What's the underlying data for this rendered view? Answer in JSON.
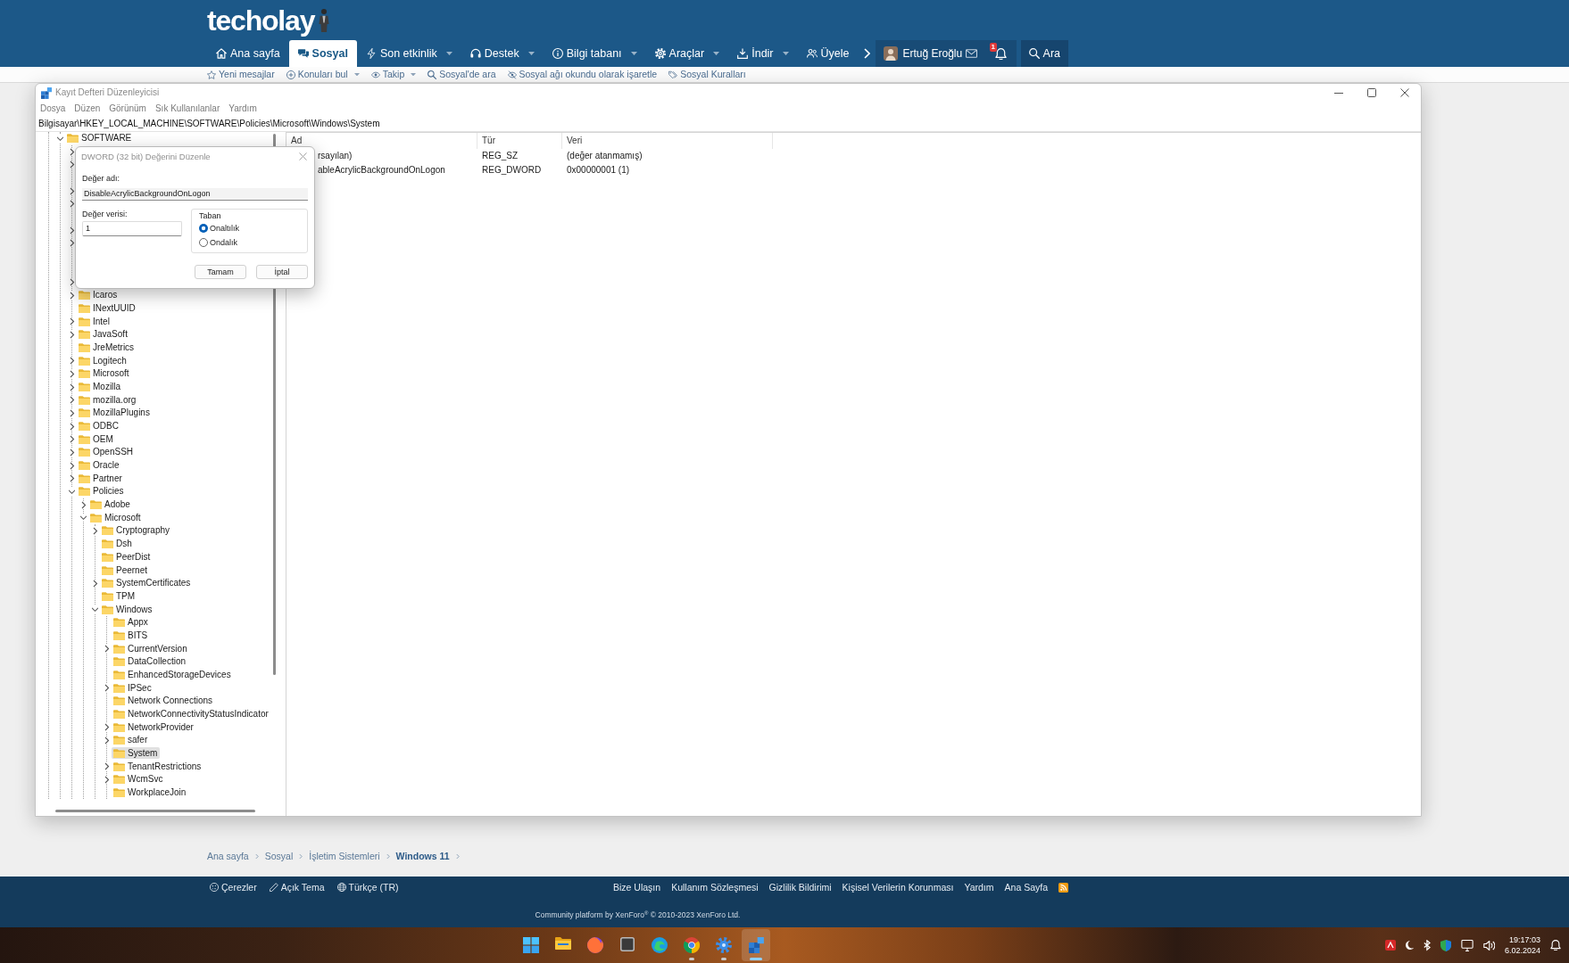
{
  "site": {
    "logo": "techolay",
    "nav": [
      {
        "label": "Ana sayfa",
        "selected": false,
        "has_menu": false
      },
      {
        "label": "Sosyal",
        "selected": true,
        "has_menu": false
      },
      {
        "label": "Son etkinlik",
        "selected": false,
        "has_menu": true
      },
      {
        "label": "Destek",
        "selected": false,
        "has_menu": true
      },
      {
        "label": "Bilgi tabanı",
        "selected": false,
        "has_menu": true
      },
      {
        "label": "Araçlar",
        "selected": false,
        "has_menu": true
      },
      {
        "label": "İndir",
        "selected": false,
        "has_menu": true
      },
      {
        "label": "Üyele",
        "selected": false,
        "has_menu": false
      }
    ],
    "account": {
      "user": "Ertuğ Eroğlu",
      "alerts": "1"
    },
    "search": "Ara",
    "subnav": [
      {
        "label": "Yeni mesajlar",
        "has_menu": false
      },
      {
        "label": "Konuları bul",
        "has_menu": true
      },
      {
        "label": "Takip",
        "has_menu": true
      },
      {
        "label": "Sosyal'de ara",
        "has_menu": false
      },
      {
        "label": "Sosyal ağı okundu olarak işaretle",
        "has_menu": false
      },
      {
        "label": "Sosyal Kuralları",
        "has_menu": false
      }
    ],
    "breadcrumb": [
      {
        "label": "Ana sayfa",
        "current": false
      },
      {
        "label": "Sosyal",
        "current": false
      },
      {
        "label": "İşletim Sistemleri",
        "current": false
      },
      {
        "label": "Windows 11",
        "current": true
      }
    ],
    "footer": {
      "left": [
        "Çerezler",
        "Açık Tema",
        "Türkçe (TR)"
      ],
      "right": [
        "Bize Ulaşın",
        "Kullanım Sözleşmesi",
        "Gizlilik Bildirimi",
        "Kişisel Verilerin Korunması",
        "Yardım",
        "Ana Sayfa"
      ],
      "copyright": "Community platform by XenForo$^{®}$ © 2010-2023 XenForo Ltd."
    }
  },
  "regedit": {
    "title": "Kayıt Defteri Düzenleyicisi",
    "menu": [
      "Dosya",
      "Düzen",
      "Görünüm",
      "Sık Kullanılanlar",
      "Yardım"
    ],
    "address": "Bilgisayar\\HKEY_LOCAL_MACHINE\\SOFTWARE\\Policies\\Microsoft\\Windows\\System",
    "tree": [
      {
        "label": "SOFTWARE",
        "expandable": true,
        "expanded": true,
        "selected": false,
        "children": [
          {
            "expandable": true,
            "expanded": false
          },
          {
            "expandable": true,
            "expanded": false
          },
          {
            "expandable": false
          },
          {
            "expandable": true,
            "expanded": false
          },
          {
            "expandable": true,
            "expanded": false
          },
          {
            "expandable": false
          },
          {
            "expandable": true,
            "expanded": false
          },
          {
            "expandable": true,
            "expanded": false
          },
          {
            "expandable": false
          },
          {
            "expandable": false
          },
          {
            "expandable": true,
            "expanded": false
          },
          {
            "label": "Icaros",
            "expandable": true,
            "expanded": false,
            "selected": false
          },
          {
            "label": "INextUUID",
            "expandable": false,
            "selected": false
          },
          {
            "label": "Intel",
            "expandable": true,
            "expanded": false,
            "selected": false
          },
          {
            "label": "JavaSoft",
            "expandable": true,
            "expanded": false,
            "selected": false
          },
          {
            "label": "JreMetrics",
            "expandable": false,
            "selected": false
          },
          {
            "label": "Logitech",
            "expandable": true,
            "expanded": false,
            "selected": false
          },
          {
            "label": "Microsoft",
            "expandable": true,
            "expanded": false,
            "selected": false
          },
          {
            "label": "Mozilla",
            "expandable": true,
            "expanded": false,
            "selected": false
          },
          {
            "label": "mozilla.org",
            "expandable": true,
            "expanded": false,
            "selected": false
          },
          {
            "label": "MozillaPlugins",
            "expandable": true,
            "expanded": false,
            "selected": false
          },
          {
            "label": "ODBC",
            "expandable": true,
            "expanded": false,
            "selected": false
          },
          {
            "label": "OEM",
            "expandable": true,
            "expanded": false,
            "selected": false
          },
          {
            "label": "OpenSSH",
            "expandable": true,
            "expanded": false,
            "selected": false
          },
          {
            "label": "Oracle",
            "expandable": true,
            "expanded": false,
            "selected": false
          },
          {
            "label": "Partner",
            "expandable": true,
            "expanded": false,
            "selected": false
          },
          {
            "label": "Policies",
            "expandable": true,
            "expanded": true,
            "selected": false,
            "children": [
              {
                "label": "Adobe",
                "expandable": true,
                "expanded": false,
                "selected": false
              },
              {
                "label": "Microsoft",
                "expandable": true,
                "expanded": true,
                "selected": false,
                "children": [
                  {
                    "label": "Cryptography",
                    "expandable": true,
                    "expanded": false,
                    "selected": false
                  },
                  {
                    "label": "Dsh",
                    "expandable": false,
                    "selected": false
                  },
                  {
                    "label": "PeerDist",
                    "expandable": false,
                    "selected": false
                  },
                  {
                    "label": "Peernet",
                    "expandable": false,
                    "selected": false
                  },
                  {
                    "label": "SystemCertificates",
                    "expandable": true,
                    "expanded": false,
                    "selected": false
                  },
                  {
                    "label": "TPM",
                    "expandable": false,
                    "selected": false
                  },
                  {
                    "label": "Windows",
                    "expandable": true,
                    "expanded": true,
                    "selected": false,
                    "children": [
                      {
                        "label": "Appx",
                        "expandable": false,
                        "selected": false
                      },
                      {
                        "label": "BITS",
                        "expandable": false,
                        "selected": false
                      },
                      {
                        "label": "CurrentVersion",
                        "expandable": true,
                        "expanded": false,
                        "selected": false
                      },
                      {
                        "label": "DataCollection",
                        "expandable": false,
                        "selected": false
                      },
                      {
                        "label": "EnhancedStorageDevices",
                        "expandable": false,
                        "selected": false
                      },
                      {
                        "label": "IPSec",
                        "expandable": true,
                        "expanded": false,
                        "selected": false
                      },
                      {
                        "label": "Network Connections",
                        "expandable": false,
                        "selected": false
                      },
                      {
                        "label": "NetworkConnectivityStatusIndicator",
                        "expandable": false,
                        "selected": false
                      },
                      {
                        "label": "NetworkProvider",
                        "expandable": true,
                        "expanded": false,
                        "selected": false
                      },
                      {
                        "label": "safer",
                        "expandable": true,
                        "expanded": false,
                        "selected": false
                      },
                      {
                        "label": "System",
                        "expandable": false,
                        "selected": true
                      },
                      {
                        "label": "TenantRestrictions",
                        "expandable": true,
                        "expanded": false,
                        "selected": false
                      },
                      {
                        "label": "WcmSvc",
                        "expandable": true,
                        "expanded": false,
                        "selected": false
                      },
                      {
                        "label": "WorkplaceJoin",
                        "expandable": false,
                        "selected": false
                      }
                    ]
                  }
                ]
              }
            ]
          }
        ]
      }
    ],
    "columns": [
      "Ad",
      "Tür",
      "Veri"
    ],
    "values": [
      {
        "name": "rsayılan)",
        "type": "REG_SZ",
        "data": "(değer atanmamış)"
      },
      {
        "name": "ableAcrylicBackgroundOnLogon",
        "type": "REG_DWORD",
        "data": "0x00000001 (1)"
      }
    ]
  },
  "dialog": {
    "title": "DWORD (32 bit) Değerini Düzenle",
    "name_label": "Değer adı:",
    "name_value": "DisableAcrylicBackgroundOnLogon",
    "data_label": "Değer verisi:",
    "data_value": "1",
    "base_label": "Taban",
    "base_options": [
      {
        "label": "Onaltılık",
        "selected": true
      },
      {
        "label": "Ondalık",
        "selected": false
      }
    ],
    "buttons": [
      "Tamam",
      "İptal"
    ]
  },
  "taskbar": {
    "apps": [
      {
        "running": false,
        "active": false
      },
      {
        "running": false,
        "active": false
      },
      {
        "running": false,
        "active": false
      },
      {
        "running": false,
        "active": false
      },
      {
        "running": true,
        "active": false
      },
      {
        "running": true,
        "active": false
      },
      {
        "running": true,
        "active": true
      }
    ],
    "clock": {
      "time": "19:17:03",
      "date": "6.02.2024"
    }
  }
}
